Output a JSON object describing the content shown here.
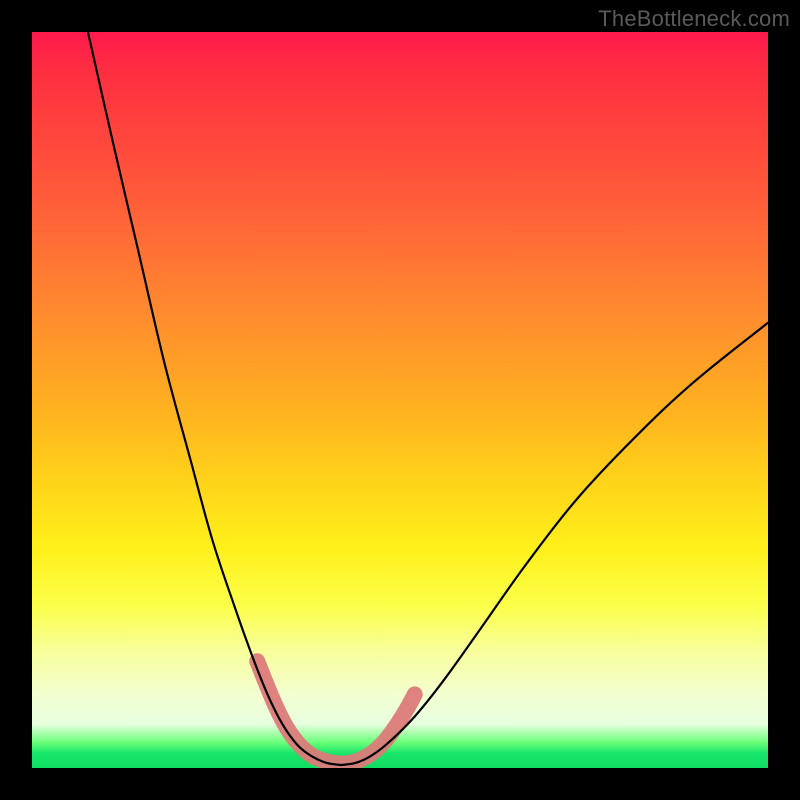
{
  "watermark": "TheBottleneck.com",
  "chart_data": {
    "type": "line",
    "title": "",
    "xlabel": "",
    "ylabel": "",
    "x_range": [
      0,
      100
    ],
    "y_range": [
      0,
      100
    ],
    "background_gradient": {
      "stops": [
        {
          "pos": 0.0,
          "color": "#ff1a4d"
        },
        {
          "pos": 0.22,
          "color": "#ff5a3a"
        },
        {
          "pos": 0.52,
          "color": "#ffb41f"
        },
        {
          "pos": 0.78,
          "color": "#fbff4a"
        },
        {
          "pos": 0.94,
          "color": "#e8ffe0"
        },
        {
          "pos": 0.98,
          "color": "#18e66a"
        },
        {
          "pos": 1.0,
          "color": "#0fdc62"
        }
      ]
    },
    "series": [
      {
        "name": "left-branch",
        "stroke": "#000000",
        "stroke_width": 2.2,
        "points": [
          {
            "x": 7.6,
            "y": 100.0
          },
          {
            "x": 11.0,
            "y": 85.0
          },
          {
            "x": 14.5,
            "y": 70.0
          },
          {
            "x": 18.0,
            "y": 55.0
          },
          {
            "x": 21.5,
            "y": 42.0
          },
          {
            "x": 24.5,
            "y": 31.0
          },
          {
            "x": 27.5,
            "y": 22.0
          },
          {
            "x": 30.0,
            "y": 15.0
          },
          {
            "x": 32.0,
            "y": 10.0
          },
          {
            "x": 34.0,
            "y": 6.0
          },
          {
            "x": 36.0,
            "y": 3.2
          },
          {
            "x": 38.0,
            "y": 1.6
          },
          {
            "x": 40.0,
            "y": 0.7
          },
          {
            "x": 42.0,
            "y": 0.4
          }
        ]
      },
      {
        "name": "right-branch",
        "stroke": "#000000",
        "stroke_width": 2.2,
        "points": [
          {
            "x": 42.0,
            "y": 0.4
          },
          {
            "x": 44.0,
            "y": 0.7
          },
          {
            "x": 46.0,
            "y": 1.6
          },
          {
            "x": 48.5,
            "y": 3.5
          },
          {
            "x": 52.0,
            "y": 7.0
          },
          {
            "x": 56.0,
            "y": 12.0
          },
          {
            "x": 61.0,
            "y": 19.0
          },
          {
            "x": 67.0,
            "y": 27.5
          },
          {
            "x": 74.0,
            "y": 36.5
          },
          {
            "x": 82.0,
            "y": 45.0
          },
          {
            "x": 90.0,
            "y": 52.5
          },
          {
            "x": 100.0,
            "y": 60.5
          }
        ]
      },
      {
        "name": "valley-highlight",
        "stroke": "#dd7a7a",
        "stroke_width": 16,
        "linecap": "round",
        "points": [
          {
            "x": 30.6,
            "y": 14.5
          },
          {
            "x": 31.8,
            "y": 11.5
          },
          {
            "x": 33.2,
            "y": 8.2
          },
          {
            "x": 34.6,
            "y": 5.5
          },
          {
            "x": 36.2,
            "y": 3.3
          },
          {
            "x": 38.0,
            "y": 1.7
          },
          {
            "x": 40.0,
            "y": 0.9
          },
          {
            "x": 42.0,
            "y": 0.6
          },
          {
            "x": 44.0,
            "y": 0.9
          },
          {
            "x": 46.0,
            "y": 1.9
          },
          {
            "x": 47.8,
            "y": 3.5
          },
          {
            "x": 49.4,
            "y": 5.6
          },
          {
            "x": 50.8,
            "y": 7.8
          },
          {
            "x": 52.0,
            "y": 10.0
          }
        ]
      }
    ],
    "annotations": []
  }
}
